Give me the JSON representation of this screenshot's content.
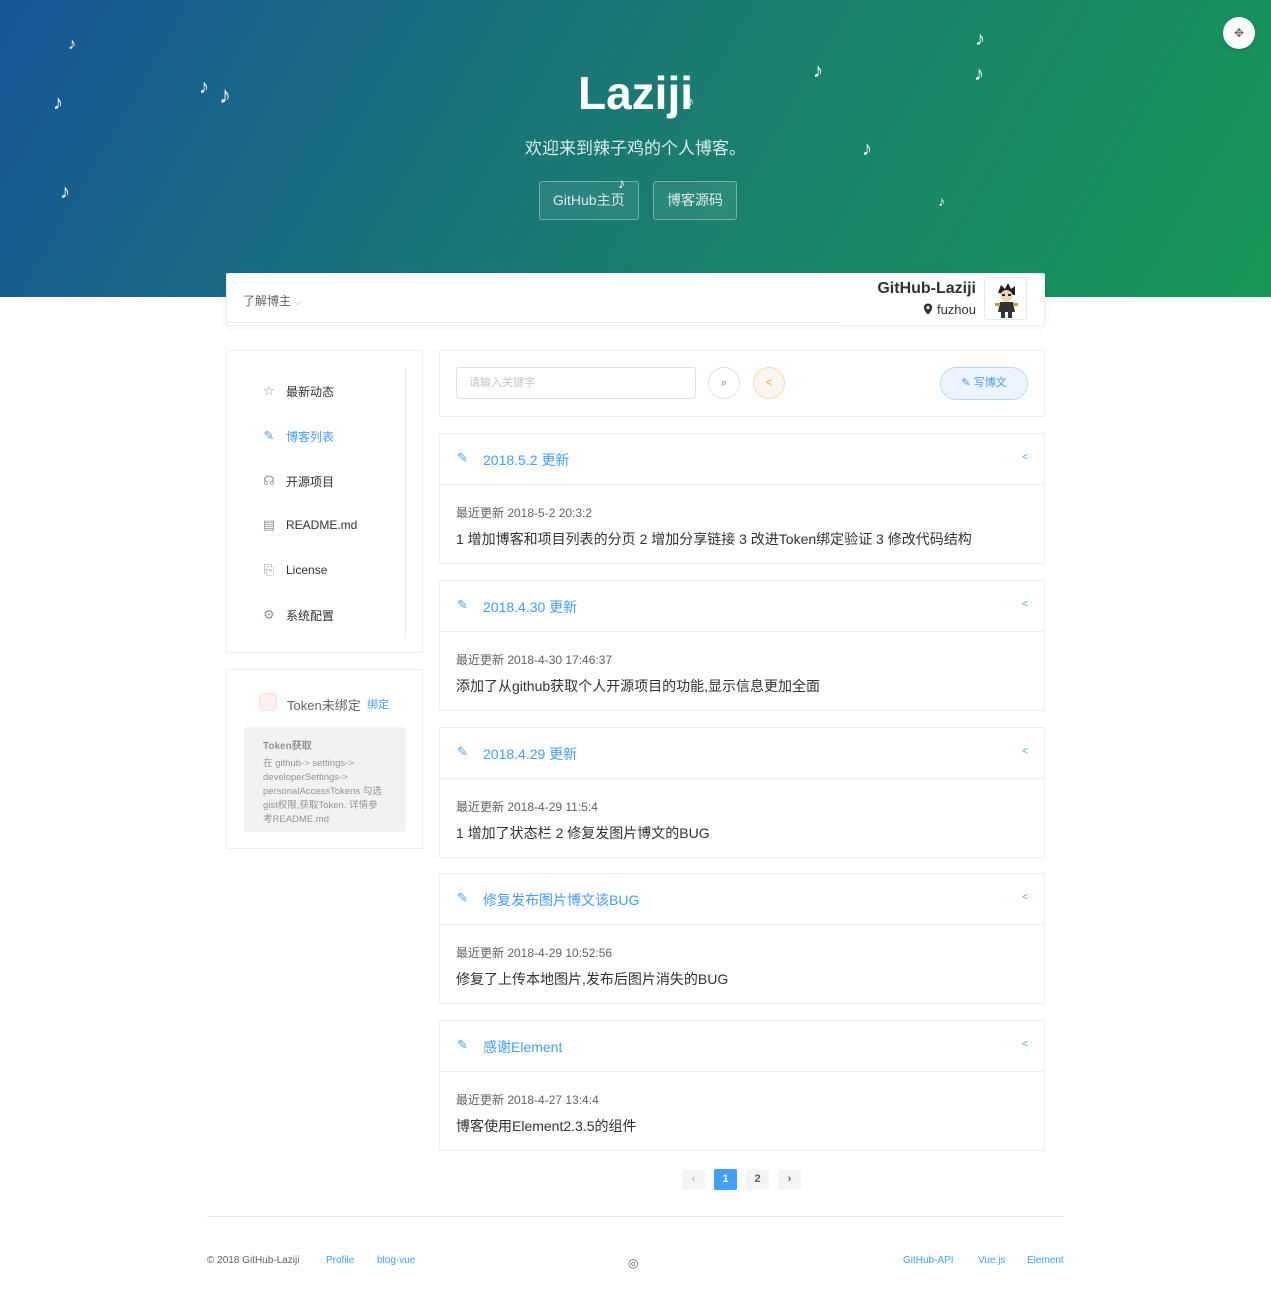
{
  "hero": {
    "title": "Laziji",
    "subtitle": "欢迎来到辣子鸡的个人博客。",
    "buttons": [
      "GitHub主页",
      "博客源码"
    ],
    "music_note": "♪"
  },
  "topbar": {
    "about_label": "了解博主",
    "github_name": "GitHub-Laziji",
    "location": "fuzhou"
  },
  "side_menu": {
    "items": [
      {
        "label": "最新动态",
        "icon": "star-icon"
      },
      {
        "label": "博客列表",
        "icon": "edit-icon",
        "active": true
      },
      {
        "label": "开源项目",
        "icon": "headset-icon"
      },
      {
        "label": "README.md",
        "icon": "document-icon"
      },
      {
        "label": "License",
        "icon": "license-icon"
      },
      {
        "label": "系统配置",
        "icon": "settings-icon"
      }
    ]
  },
  "token": {
    "label": "Token未绑定",
    "bind_label": "绑定",
    "help_title": "Token获取",
    "help_text": "在 github-> settings-> developerSettings-> personalAccessTokens 勾选gist权限,获取Token. 详情参考README.md"
  },
  "search": {
    "placeholder": "请输入关键字",
    "write_label": "写博文"
  },
  "posts": [
    {
      "title": "2018.5.2 更新",
      "meta": "最近更新 2018-5-2 20:3:2",
      "body": "1 增加博客和项目列表的分页 2 增加分享链接 3 改进Token绑定验证 3 修改代码结构"
    },
    {
      "title": "2018.4.30 更新",
      "meta": "最近更新 2018-4-30 17:46:37",
      "body": "添加了从github获取个人开源项目的功能,显示信息更加全面"
    },
    {
      "title": "2018.4.29 更新",
      "meta": "最近更新 2018-4-29 11:5:4",
      "body": "1 增加了状态栏 2 修复发图片博文的BUG"
    },
    {
      "title": "修复发布图片博文该BUG",
      "meta": "最近更新 2018-4-29 10:52:56",
      "body": "修复了上传本地图片,发布后图片消失的BUG"
    },
    {
      "title": "感谢Element",
      "meta": "最近更新 2018-4-27 13:4:4",
      "body": "博客使用Element2.3.5的组件"
    }
  ],
  "pagination": {
    "prev": "‹",
    "pages": [
      "1",
      "2"
    ],
    "current": "1",
    "next": "›"
  },
  "footer": {
    "copyright": "© 2018 GitHub-Laziji",
    "left_links": [
      "Profile",
      "blog-vue"
    ],
    "right_links": [
      "GitHub-API",
      "Vue.js",
      "Element"
    ]
  },
  "colors": {
    "accent": "#409eff",
    "hero_start": "#155799",
    "hero_end": "#159957",
    "share_orange": "#e6a23c"
  }
}
